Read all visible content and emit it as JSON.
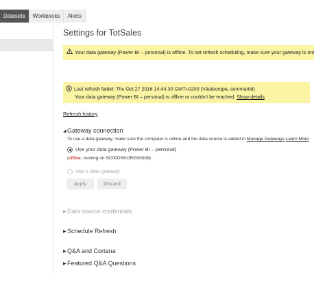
{
  "tabs": [
    {
      "label": "Datasets"
    },
    {
      "label": "Workbooks"
    },
    {
      "label": "Alerts"
    }
  ],
  "page": {
    "title": "Settings for TotSales"
  },
  "warning": {
    "text": "Your data gateway (Power BI – personal) is offline. To set refresh scheduling, make sure your gateway is online."
  },
  "error": {
    "line1": "Last refresh failed: Thu Oct 27 2016 14:44:30 GMT+0200 (Västeuropa, sommartid)",
    "line2": "Your data gateway (Power BI – personal) is offline or couldn’t be reached.",
    "details_link": "Show details"
  },
  "refresh_history": "Refresh history",
  "gateway": {
    "heading": "Gateway connection",
    "desc_prefix": "To use a data gateway, make sure the computer is online and the data source is added in",
    "manage_link": "Manage Gateways",
    "learn_link": "Learn More",
    "option_personal": "Use your data gateway (Power BI – personal)",
    "status_open": "(",
    "status_offline": "offline",
    "status_rest": ", running on SC00DSKORG00008)",
    "option_data": "Use a data gateway",
    "apply": "Apply",
    "discard": "Discard"
  },
  "sections": {
    "data_source": "Data source credentials",
    "schedule": "Schedule Refresh",
    "qna": "Q&A and Cortana",
    "featured": "Featured Q&A Questions"
  }
}
